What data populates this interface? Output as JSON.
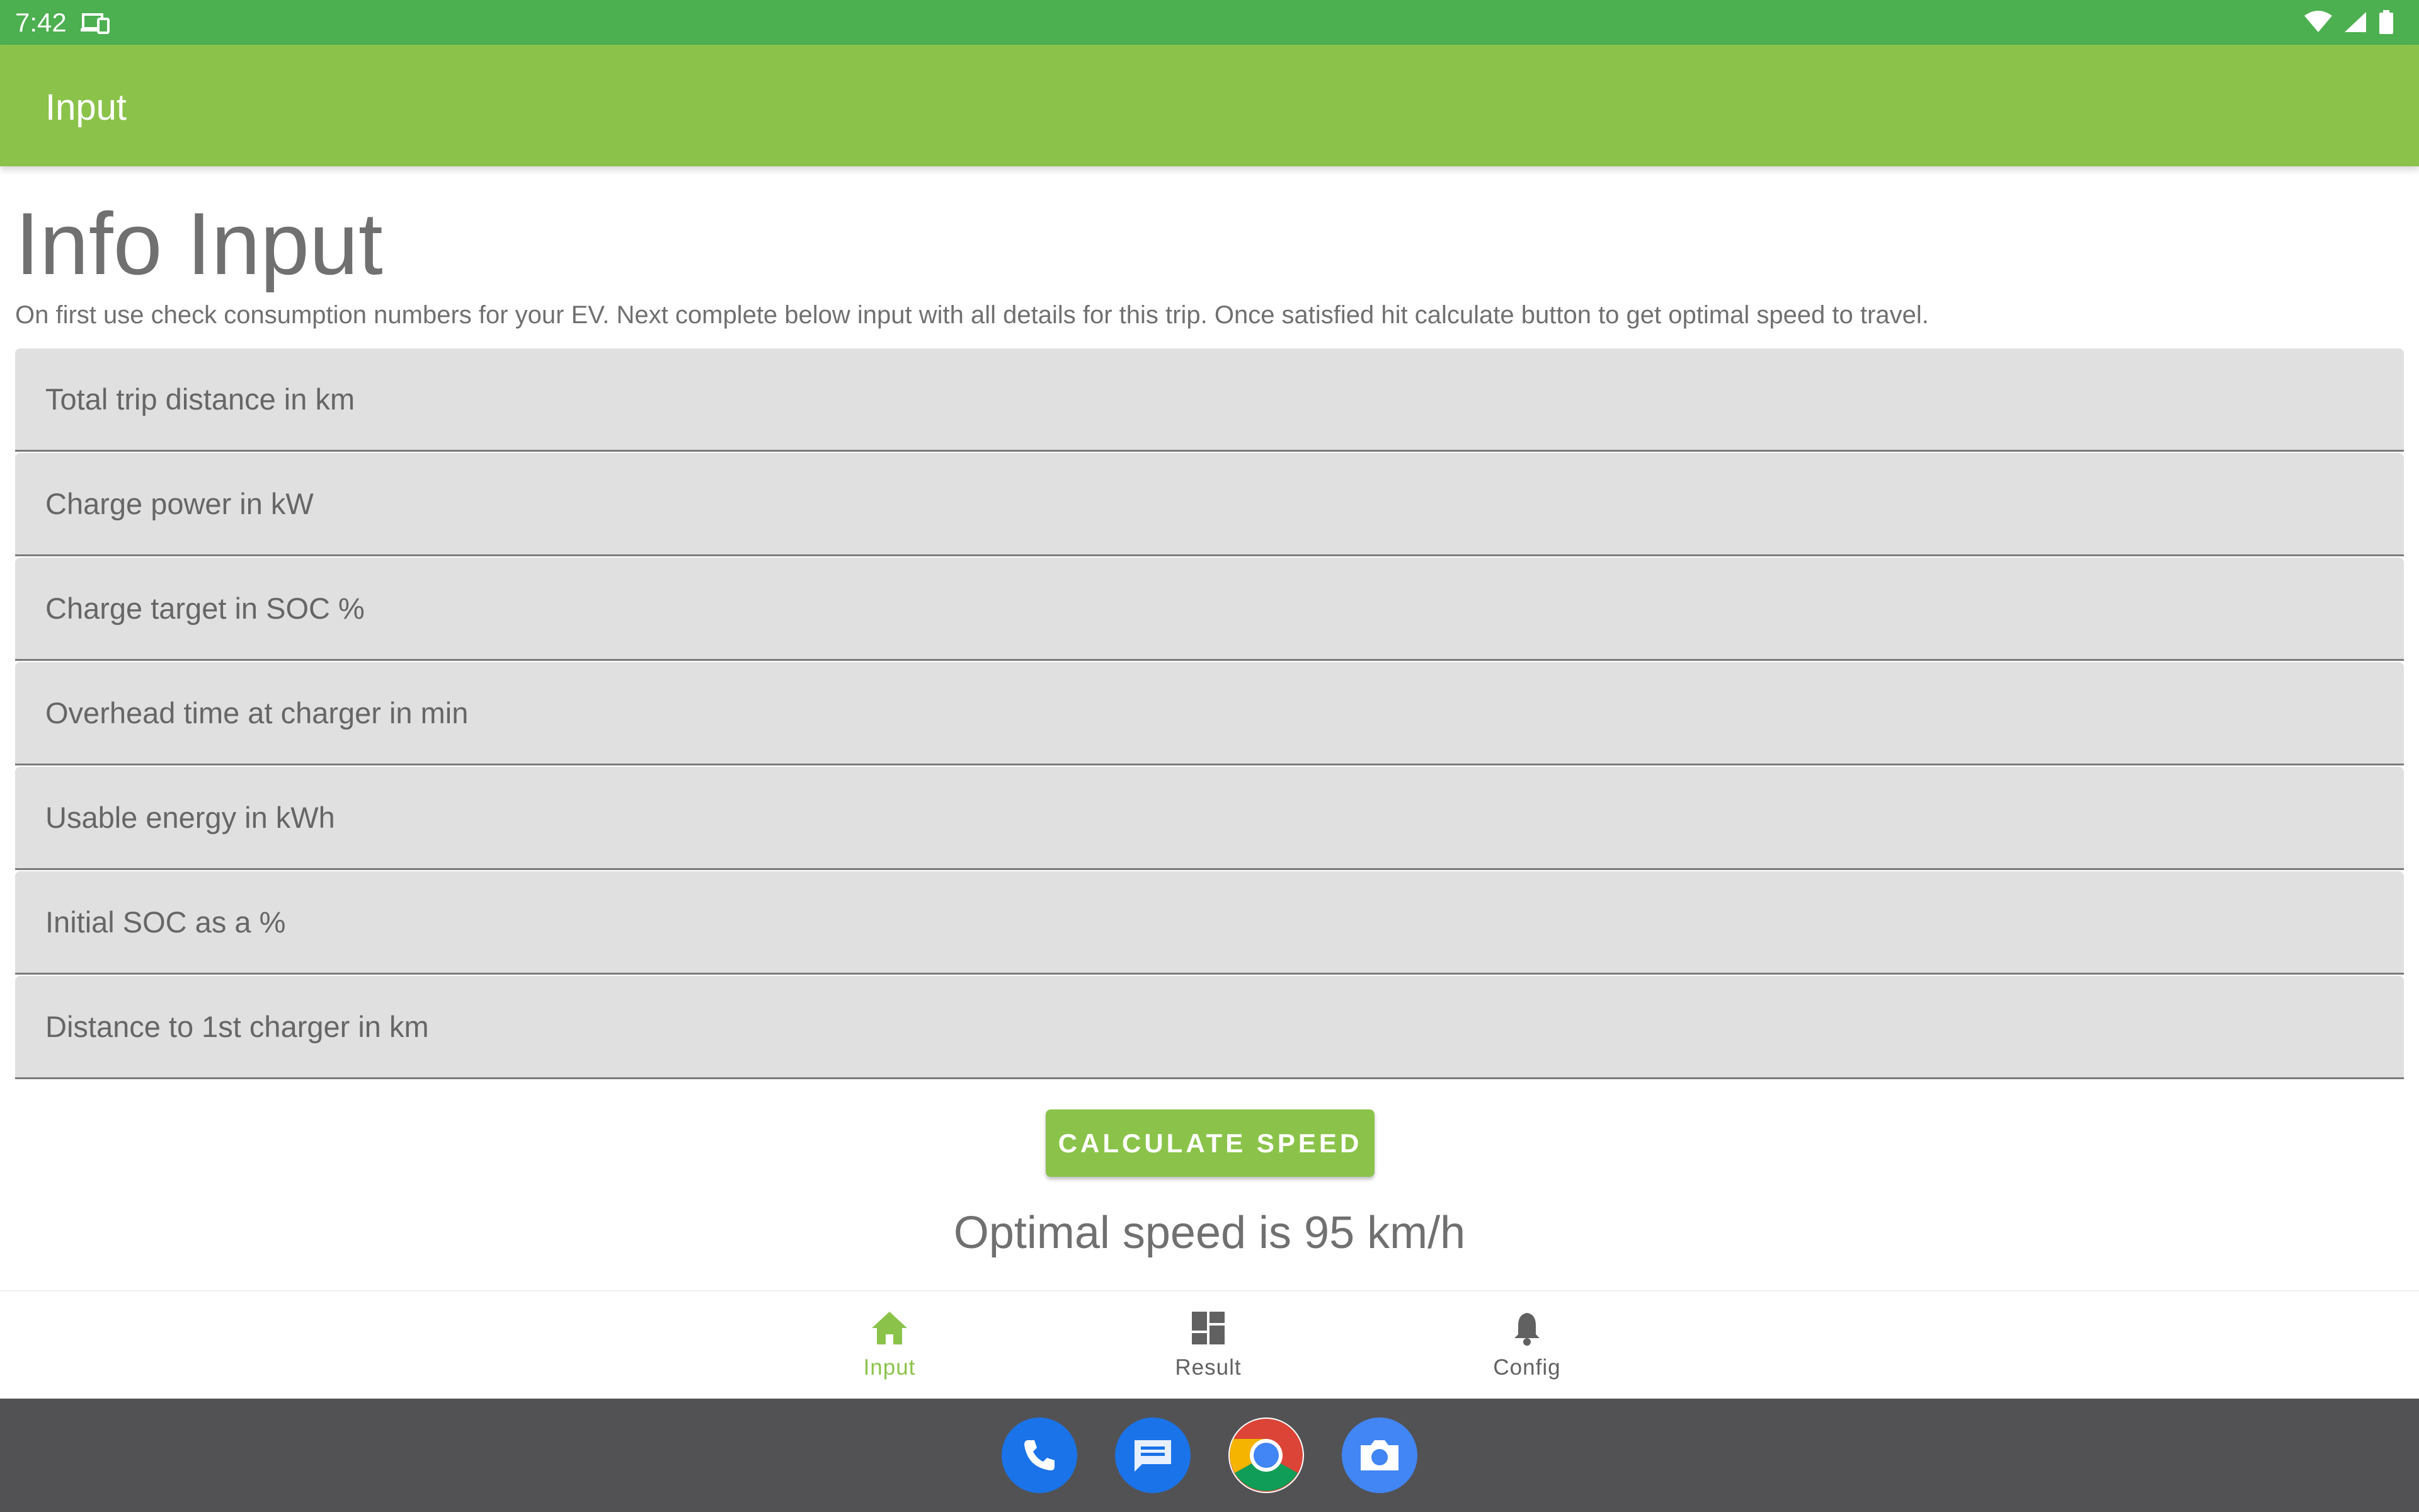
{
  "status_bar": {
    "time": "7:42",
    "icons": [
      "cast-icon",
      "wifi-icon",
      "cellular-signal-icon",
      "battery-icon"
    ]
  },
  "app_bar": {
    "title": "Input"
  },
  "content": {
    "heading": "Info Input",
    "description": "On first use check consumption numbers for your EV. Next complete below input with all details for this trip. Once satisfied hit calculate button to get optimal speed to travel.",
    "fields": [
      {
        "placeholder": "Total trip distance in km",
        "value": ""
      },
      {
        "placeholder": "Charge power in kW",
        "value": ""
      },
      {
        "placeholder": "Charge target in SOC %",
        "value": ""
      },
      {
        "placeholder": "Overhead time at charger in min",
        "value": ""
      },
      {
        "placeholder": "Usable energy in kWh",
        "value": ""
      },
      {
        "placeholder": "Initial SOC as a %",
        "value": ""
      },
      {
        "placeholder": "Distance to 1st charger in km",
        "value": ""
      }
    ],
    "calculate_button": "CALCULATE SPEED",
    "result_text": "Optimal speed is 95 km/h"
  },
  "bottom_nav": {
    "items": [
      {
        "label": "Input",
        "icon": "home-icon",
        "active": true
      },
      {
        "label": "Result",
        "icon": "dashboard-icon",
        "active": false
      },
      {
        "label": "Config",
        "icon": "bell-icon",
        "active": false
      }
    ]
  },
  "dock": {
    "apps": [
      "phone-icon",
      "messages-icon",
      "chrome-icon",
      "camera-icon"
    ]
  },
  "colors": {
    "status_bar": "#4caf50",
    "app_bar": "#8bc34a",
    "accent": "#8bc34a",
    "field_bg": "#e0e0e0",
    "dock_bg": "#525254"
  }
}
